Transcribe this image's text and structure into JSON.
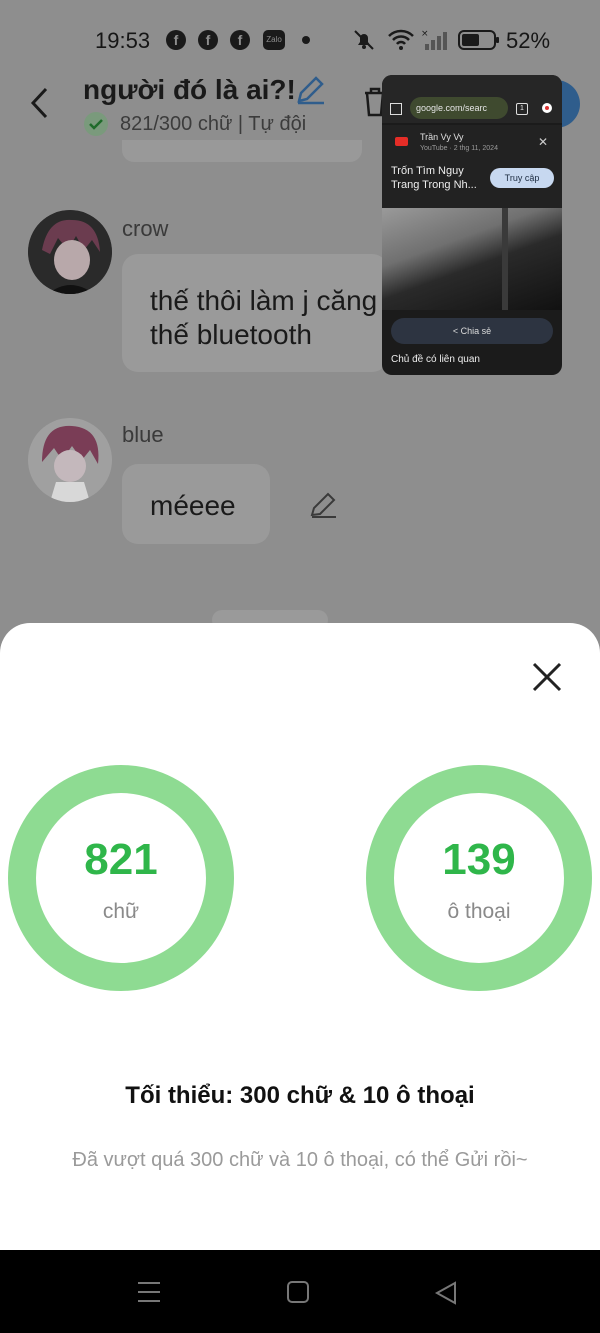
{
  "status_bar": {
    "time": "19:53",
    "facebook_glyph": "f",
    "zalo_label": "Zalo",
    "battery_percent": "52%",
    "icons": [
      "facebook-icon",
      "facebook-icon",
      "facebook-icon",
      "zalo-icon",
      "dot-icon",
      "mute-bell-icon",
      "wifi-icon",
      "signal-icon",
      "battery-icon"
    ]
  },
  "header": {
    "title": "người đó là ai?!",
    "subtitle": "821/300 chữ | Tự đội"
  },
  "messages": [
    {
      "sender": "crow",
      "lines": [
        "thế thôi làm j căng",
        "thế bluetooth"
      ]
    },
    {
      "sender": "blue",
      "lines": [
        "méeee"
      ]
    }
  ],
  "pip": {
    "url": "google.com/searc",
    "tabs_count": "1",
    "channel": "Trần Vy Vy",
    "meta": "YouTube · 2 thg 11, 2024",
    "video_title": "Trốn Tìm Nguy Trang Trong Nh...",
    "visit_label": "Truy cập",
    "share_label": "Chia sẻ",
    "related_label": "Chủ đề có liên quan"
  },
  "sheet": {
    "stats": [
      {
        "value": "821",
        "label": "chữ"
      },
      {
        "value": "139",
        "label": "ô thoại"
      }
    ],
    "minimum": "Tối thiểu: 300 chữ & 10 ô thoại",
    "note": "Đã vượt quá 300 chữ và 10 ô thoại, có thể Gửi rồi~"
  },
  "colors": {
    "ring": "#8edb92",
    "stat_value": "#2fb64a",
    "accent_blue": "#2f5d8c"
  }
}
